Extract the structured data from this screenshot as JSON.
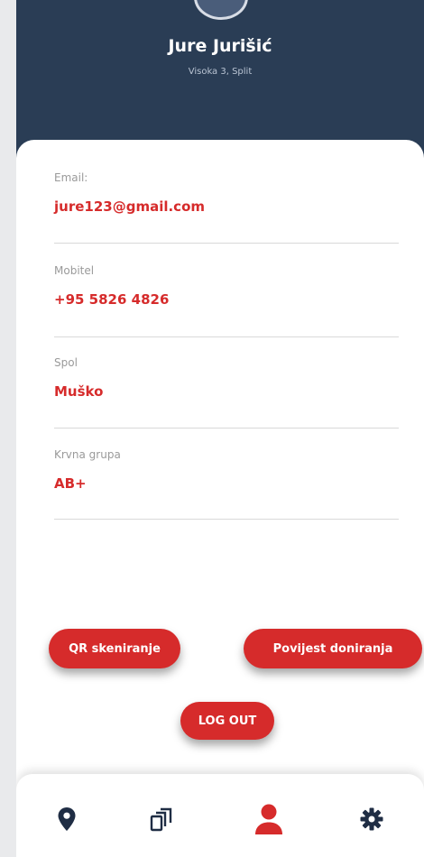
{
  "profile": {
    "name": "Jure Jurišić",
    "address": "Visoka 3, Split"
  },
  "fields": {
    "email": {
      "label": "Email:",
      "value": "jure123@gmail.com"
    },
    "mobile": {
      "label": "Mobitel",
      "value": "+95 5826 4826"
    },
    "gender": {
      "label": "Spol",
      "value": "Muško"
    },
    "blood": {
      "label": "Krvna grupa",
      "value": "AB+"
    }
  },
  "actions": {
    "qr_label": "QR skeniranje",
    "history_label": "Povijest doniranja",
    "logout_label": "LOG OUT"
  },
  "nav": {
    "items": [
      {
        "icon": "map-pin-icon",
        "active": false
      },
      {
        "icon": "cards-icon",
        "active": false
      },
      {
        "icon": "user-icon",
        "active": true
      },
      {
        "icon": "gear-icon",
        "active": false
      }
    ]
  },
  "colors": {
    "header": "#2a3d55",
    "accent": "#d62b2b",
    "nav_inactive": "#1f2d44"
  }
}
